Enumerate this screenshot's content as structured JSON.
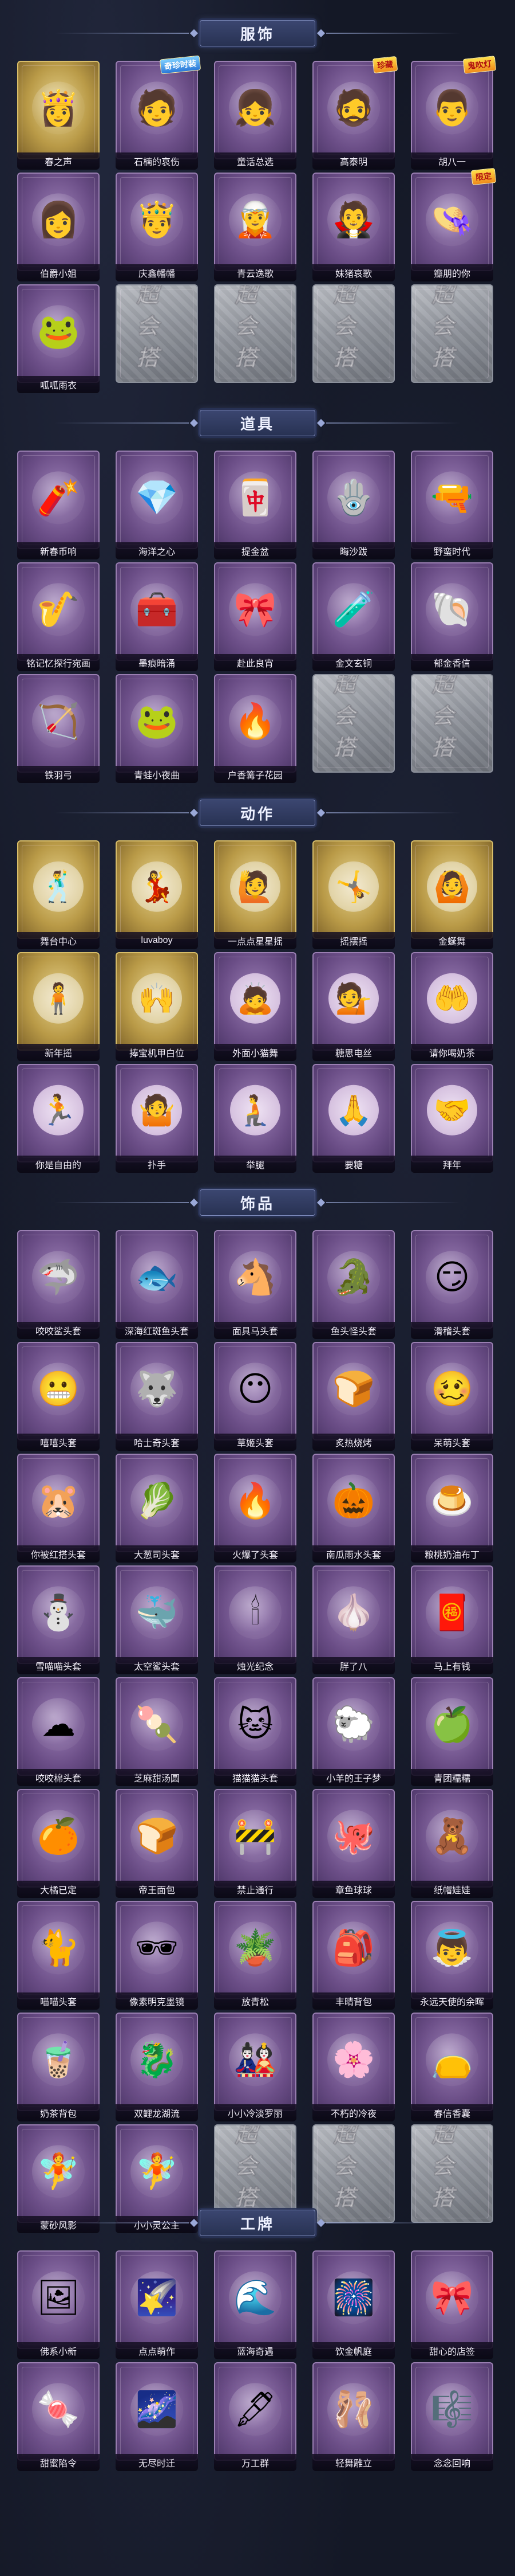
{
  "sections": [
    {
      "id": "clothing",
      "title": "服饰",
      "items": [
        {
          "label": "春之声",
          "rarity": "gold",
          "icon": "👸"
        },
        {
          "label": "石楠的哀伤",
          "rarity": "purple",
          "icon": "🧑",
          "badge": "奇珍时装"
        },
        {
          "label": "童话总选",
          "rarity": "purple",
          "icon": "👧"
        },
        {
          "label": "高泰明",
          "rarity": "purple",
          "icon": "🧔",
          "badge": "珍藏"
        },
        {
          "label": "胡八一",
          "rarity": "purple",
          "icon": "👨",
          "badge": "鬼吹灯"
        },
        {
          "label": "伯爵小姐",
          "rarity": "purple",
          "icon": "👩"
        },
        {
          "label": "庆鑫幡幡",
          "rarity": "purple",
          "icon": "🤴"
        },
        {
          "label": "青云逸歌",
          "rarity": "purple",
          "icon": "🧝"
        },
        {
          "label": "妹猪哀歌",
          "rarity": "purple",
          "icon": "🧛"
        },
        {
          "label": "瓣朋的你",
          "rarity": "purple",
          "icon": "👒",
          "badge": "限定"
        },
        {
          "label": "呱呱雨衣",
          "rarity": "purple",
          "icon": "🐸"
        },
        {
          "label": "",
          "rarity": "locked",
          "icon": ""
        },
        {
          "label": "",
          "rarity": "locked",
          "icon": ""
        },
        {
          "label": "",
          "rarity": "locked",
          "icon": ""
        },
        {
          "label": "",
          "rarity": "locked",
          "icon": ""
        }
      ]
    },
    {
      "id": "props",
      "title": "道具",
      "items": [
        {
          "label": "新春币响",
          "rarity": "purple",
          "icon": "🧨"
        },
        {
          "label": "海洋之心",
          "rarity": "purple",
          "icon": "💎"
        },
        {
          "label": "提金盆",
          "rarity": "purple",
          "icon": "🀄"
        },
        {
          "label": "晦沙跋",
          "rarity": "purple",
          "icon": "🪬"
        },
        {
          "label": "野蛮时代",
          "rarity": "purple",
          "icon": "🔫"
        },
        {
          "label": "铭记忆探行宛画",
          "rarity": "purple",
          "icon": "🎷"
        },
        {
          "label": "墨痕暗涌",
          "rarity": "purple",
          "icon": "🧰"
        },
        {
          "label": "赴此良宵",
          "rarity": "purple",
          "icon": "🎀"
        },
        {
          "label": "金文玄铜",
          "rarity": "purple",
          "icon": "🧪"
        },
        {
          "label": "郁金香信",
          "rarity": "purple",
          "icon": "🐚"
        },
        {
          "label": "铁羽弓",
          "rarity": "purple",
          "icon": "🏹"
        },
        {
          "label": "青蛙小夜曲",
          "rarity": "purple",
          "icon": "🐸"
        },
        {
          "label": "户香篝子花园",
          "rarity": "purple",
          "icon": "🔥"
        },
        {
          "label": "",
          "rarity": "locked",
          "icon": ""
        },
        {
          "label": "",
          "rarity": "locked",
          "icon": ""
        }
      ]
    },
    {
      "id": "actions",
      "title": "动作",
      "items": [
        {
          "label": "舞台中心",
          "rarity": "gold",
          "icon": "🕺"
        },
        {
          "label": "luvaboy",
          "rarity": "gold",
          "icon": "💃"
        },
        {
          "label": "一点点星星摇",
          "rarity": "gold",
          "icon": "🙋"
        },
        {
          "label": "摇摆摇",
          "rarity": "gold",
          "icon": "🤸"
        },
        {
          "label": "金蜒舞",
          "rarity": "gold",
          "icon": "🙆"
        },
        {
          "label": "新年摇",
          "rarity": "gold",
          "icon": "🧍"
        },
        {
          "label": "捧宝机甲白位",
          "rarity": "gold",
          "icon": "🙌"
        },
        {
          "label": "外面小猫舞",
          "rarity": "purple",
          "icon": "🙇"
        },
        {
          "label": "糖思电丝",
          "rarity": "purple",
          "icon": "💁"
        },
        {
          "label": "请你喝奶茶",
          "rarity": "purple",
          "icon": "🤲"
        },
        {
          "label": "你是自由的",
          "rarity": "purple",
          "icon": "🏃"
        },
        {
          "label": "扑手",
          "rarity": "purple",
          "icon": "🤷"
        },
        {
          "label": "举腿",
          "rarity": "purple",
          "icon": "🧎"
        },
        {
          "label": "要糖",
          "rarity": "purple",
          "icon": "🙏"
        },
        {
          "label": "拜年",
          "rarity": "purple",
          "icon": "🤝"
        }
      ]
    },
    {
      "id": "accessories",
      "title": "饰品",
      "items": [
        {
          "label": "咬咬鲨头套",
          "rarity": "purple",
          "icon": "🦈"
        },
        {
          "label": "深海红斑鱼头套",
          "rarity": "purple",
          "icon": "🐟"
        },
        {
          "label": "面具马头套",
          "rarity": "purple",
          "icon": "🐴"
        },
        {
          "label": "鱼头怪头套",
          "rarity": "purple",
          "icon": "🐊"
        },
        {
          "label": "滑稽头套",
          "rarity": "purple",
          "icon": "😏"
        },
        {
          "label": "嘻嘻头套",
          "rarity": "purple",
          "icon": "😬"
        },
        {
          "label": "哈士奇头套",
          "rarity": "purple",
          "icon": "🐺"
        },
        {
          "label": "草姬头套",
          "rarity": "purple",
          "icon": "😶"
        },
        {
          "label": "炙热烧烤",
          "rarity": "purple",
          "icon": "🍞"
        },
        {
          "label": "呆萌头套",
          "rarity": "purple",
          "icon": "🥴"
        },
        {
          "label": "你被红搭头套",
          "rarity": "purple",
          "icon": "🐹"
        },
        {
          "label": "大葱司头套",
          "rarity": "purple",
          "icon": "🥬"
        },
        {
          "label": "火爆了头套",
          "rarity": "purple",
          "icon": "🔥"
        },
        {
          "label": "南瓜雨水头套",
          "rarity": "purple",
          "icon": "🎃"
        },
        {
          "label": "粮桃奶油布丁",
          "rarity": "purple",
          "icon": "🍮"
        },
        {
          "label": "雪喵喵头套",
          "rarity": "purple",
          "icon": "⛄"
        },
        {
          "label": "太空鲨头套",
          "rarity": "purple",
          "icon": "🐳"
        },
        {
          "label": "烛光纪念",
          "rarity": "purple",
          "icon": "🕯"
        },
        {
          "label": "胖了八",
          "rarity": "purple",
          "icon": "🧄"
        },
        {
          "label": "马上有钱",
          "rarity": "purple",
          "icon": "🧧"
        },
        {
          "label": "咬咬棉头套",
          "rarity": "purple",
          "icon": "☁"
        },
        {
          "label": "芝麻甜汤圆",
          "rarity": "purple",
          "icon": "🍡"
        },
        {
          "label": "猫猫猫头套",
          "rarity": "purple",
          "icon": "🐱"
        },
        {
          "label": "小羊的王子梦",
          "rarity": "purple",
          "icon": "🐑"
        },
        {
          "label": "青团糯糯",
          "rarity": "purple",
          "icon": "🍏"
        },
        {
          "label": "大橘已定",
          "rarity": "purple",
          "icon": "🍊"
        },
        {
          "label": "帝王面包",
          "rarity": "purple",
          "icon": "🍞"
        },
        {
          "label": "禁止通行",
          "rarity": "purple",
          "icon": "🚧"
        },
        {
          "label": "章鱼球球",
          "rarity": "purple",
          "icon": "🐙"
        },
        {
          "label": "纸帽娃娃",
          "rarity": "purple",
          "icon": "🧸"
        },
        {
          "label": "喵喵头套",
          "rarity": "purple",
          "icon": "🐈"
        },
        {
          "label": "像素明克墨镜",
          "rarity": "purple",
          "icon": "🕶"
        },
        {
          "label": "放青松",
          "rarity": "purple",
          "icon": "🪴"
        },
        {
          "label": "丰晴背包",
          "rarity": "purple",
          "icon": "🎒"
        },
        {
          "label": "永远天使的余晖",
          "rarity": "purple",
          "icon": "👼"
        },
        {
          "label": "奶茶背包",
          "rarity": "purple",
          "icon": "🧋"
        },
        {
          "label": "双鲤龙湖流",
          "rarity": "purple",
          "icon": "🐉"
        },
        {
          "label": "小小冷淡罗丽",
          "rarity": "purple",
          "icon": "🎎"
        },
        {
          "label": "不朽的冷夜",
          "rarity": "purple",
          "icon": "🌸"
        },
        {
          "label": "春信香囊",
          "rarity": "purple",
          "icon": "👝"
        },
        {
          "label": "蒙砂风影",
          "rarity": "purple",
          "icon": "🧚"
        },
        {
          "label": "小小灵公主",
          "rarity": "purple",
          "icon": "🧚"
        },
        {
          "label": "",
          "rarity": "locked",
          "icon": ""
        },
        {
          "label": "",
          "rarity": "locked",
          "icon": ""
        },
        {
          "label": "",
          "rarity": "locked",
          "icon": ""
        }
      ]
    },
    {
      "id": "badges",
      "title": "工牌",
      "items": [
        {
          "label": "佛系小新",
          "rarity": "purple",
          "icon": "🖼"
        },
        {
          "label": "点点萌作",
          "rarity": "purple",
          "icon": "🌠"
        },
        {
          "label": "蓝海奇遇",
          "rarity": "purple",
          "icon": "🌊"
        },
        {
          "label": "饮金帆庭",
          "rarity": "purple",
          "icon": "🎆"
        },
        {
          "label": "甜心的店签",
          "rarity": "purple",
          "icon": "🎀"
        },
        {
          "label": "甜蜜陷令",
          "rarity": "purple",
          "icon": "🍬"
        },
        {
          "label": "无尽时迁",
          "rarity": "purple",
          "icon": "🌌"
        },
        {
          "label": "万工群",
          "rarity": "purple",
          "icon": "🖋"
        },
        {
          "label": "轻舞雕立",
          "rarity": "purple",
          "icon": "🩰"
        },
        {
          "label": "念念回响",
          "rarity": "purple",
          "icon": "🎼"
        }
      ]
    }
  ],
  "locked_watermark": "超会搭",
  "colors": {
    "background": "#141826",
    "purple_frame": "#6a4d86",
    "gold_frame": "#b99a47",
    "locked_frame": "#8d9199",
    "section_plate": "#283253"
  }
}
